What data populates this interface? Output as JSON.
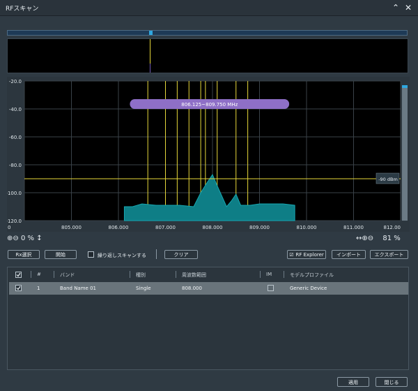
{
  "window": {
    "title": "RFスキャン",
    "collapse_glyph": "⌃",
    "close_glyph": "✕"
  },
  "chart_data": {
    "type": "area",
    "xlim": [
      804.0,
      812.0
    ],
    "ylim": [
      -120.0,
      -20.0
    ],
    "yticks": [
      "-20.0",
      "-40.0",
      "-60.0",
      "-80.0",
      "-100.0",
      "-120.0"
    ],
    "xticks": [
      "0",
      "805.000",
      "806.000",
      "807.000",
      "808.000",
      "809.000",
      "810.000",
      "811.000",
      "812.00"
    ],
    "x": [
      806.125,
      806.3,
      806.5,
      806.8,
      807.3,
      807.6,
      807.75,
      807.9,
      808.0,
      808.1,
      808.3,
      808.4,
      808.5,
      808.6,
      808.8,
      809.0,
      809.5,
      809.75
    ],
    "y": [
      -110,
      -110,
      -108,
      -109,
      -109,
      -110,
      -100,
      -92,
      -87,
      -95,
      -110,
      -106,
      -101,
      -109,
      -109,
      -108,
      -108,
      -109
    ],
    "vlines": [
      806.625,
      807.0,
      807.25,
      807.5,
      807.75,
      807.85,
      808.1,
      808.5,
      808.75
    ],
    "threshold": -90,
    "threshold_label": "-90 dBm",
    "range_label": "806.125~809.750 MHz",
    "range": [
      806.125,
      809.75
    ],
    "fill_color": "#0e7e86",
    "line_color": "#15a7b1",
    "marker_color": "#e7d83a",
    "range_color": "#8e6fc7"
  },
  "zoom": {
    "left_value": "0 %",
    "right_value": "81 %"
  },
  "controls": {
    "rx_select": "Rx選択",
    "start": "開始",
    "repeat_label": "繰り返しスキャンする",
    "clear": "クリア",
    "rf_explorer": "RF Explorer",
    "import": "インポート",
    "export": "エクスポート"
  },
  "table": {
    "headers": [
      "#",
      "バンド",
      "種別",
      "周波数範囲",
      "IM",
      "モデルプロファイル"
    ],
    "rows": [
      {
        "num": "1",
        "band": "Band Name 01",
        "type": "Single",
        "range": "808.000",
        "profile": "Generic Device"
      }
    ]
  },
  "footer": {
    "apply": "適用",
    "close": "閉じる"
  }
}
